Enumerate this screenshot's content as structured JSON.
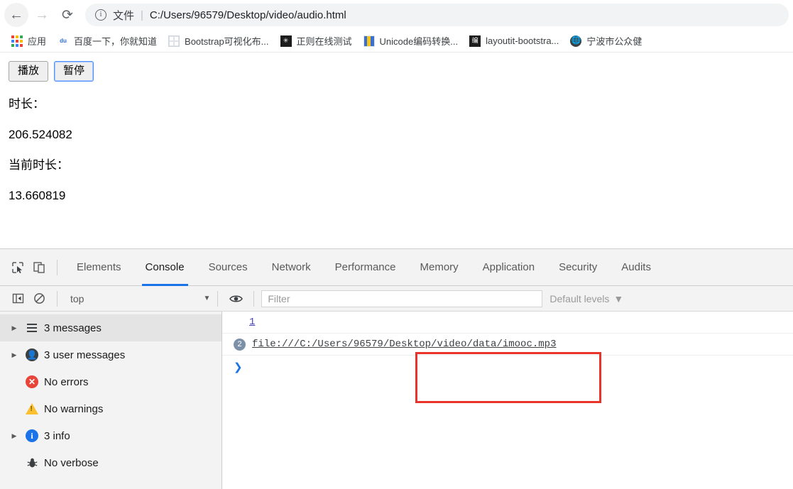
{
  "browser": {
    "nav": {
      "back_icon": "arrow-left-icon",
      "forward_icon": "arrow-right-icon",
      "reload_icon": "reload-icon",
      "info_icon": "info-circle-icon"
    },
    "omnibox": {
      "scheme_label": "文件",
      "separator": "|",
      "url": "C:/Users/96579/Desktop/video/audio.html"
    },
    "bookmarks": [
      {
        "label": "应用",
        "icon": "apps-grid-icon"
      },
      {
        "label": "百度一下，你就知道",
        "icon": "baidu-icon"
      },
      {
        "label": "Bootstrap可视化布...",
        "icon": "bootstrap-grid-icon"
      },
      {
        "label": "正则在线测试",
        "icon": "regex-dark-icon"
      },
      {
        "label": "Unicode编码转换...",
        "icon": "unicode-icon"
      },
      {
        "label": "layoutit-bootstra...",
        "icon": "layoutit-icon",
        "glyph": "编"
      },
      {
        "label": "宁波市公众健",
        "icon": "globe-dark-icon"
      }
    ]
  },
  "page": {
    "buttons": [
      {
        "label": "播放",
        "name": "play-button",
        "focused": false
      },
      {
        "label": "暂停",
        "name": "pause-button",
        "focused": true
      }
    ],
    "duration_label": "时长：",
    "duration_value": "206.524082",
    "current_label": "当前时长：",
    "current_value": "13.660819"
  },
  "devtools": {
    "inspect_icon": "inspect-element-icon",
    "device_icon": "device-toolbar-icon",
    "tabs": [
      {
        "label": "Elements",
        "active": false
      },
      {
        "label": "Console",
        "active": true
      },
      {
        "label": "Sources",
        "active": false
      },
      {
        "label": "Network",
        "active": false
      },
      {
        "label": "Performance",
        "active": false
      },
      {
        "label": "Memory",
        "active": false
      },
      {
        "label": "Application",
        "active": false
      },
      {
        "label": "Security",
        "active": false
      },
      {
        "label": "Audits",
        "active": false
      }
    ],
    "console_toolbar": {
      "sidebar_toggle_icon": "sidebar-toggle-icon",
      "clear_icon": "clear-console-icon",
      "context": "top",
      "context_caret": "▼",
      "eye_icon": "live-expression-eye-icon",
      "filter_placeholder": "Filter",
      "levels_label": "Default levels",
      "levels_caret": "▼"
    },
    "sidebar": [
      {
        "label": "3 messages",
        "icon": "list-icon",
        "expandable": true,
        "selected": true
      },
      {
        "label": "3 user messages",
        "icon": "user-icon",
        "expandable": true,
        "selected": false
      },
      {
        "label": "No errors",
        "icon": "error-icon",
        "expandable": false,
        "selected": false
      },
      {
        "label": "No warnings",
        "icon": "warning-icon",
        "expandable": false,
        "selected": false
      },
      {
        "label": "3 info",
        "icon": "info-icon",
        "expandable": true,
        "selected": false
      },
      {
        "label": "No verbose",
        "icon": "bug-icon",
        "expandable": false,
        "selected": false
      }
    ],
    "output": {
      "row_one_value": "1",
      "badge_count": "2",
      "file_url": "file:///C:/Users/96579/Desktop/video/data/imooc.mp3",
      "prompt": "❯"
    }
  },
  "annotation": {
    "name": "red-highlight-box",
    "color": "#e8342a"
  }
}
